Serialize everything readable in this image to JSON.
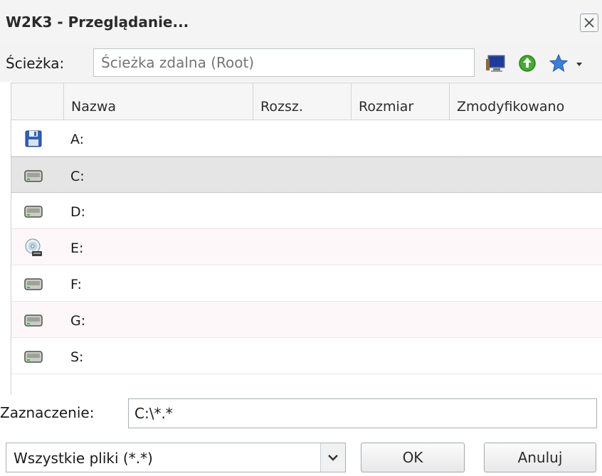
{
  "window": {
    "title": "W2K3 - Przeglądanie..."
  },
  "path": {
    "label": "Ścieżka:",
    "placeholder": "Ścieżka zdalna (Root)"
  },
  "toolbar_icons": [
    "desktop-icon",
    "go-up-icon",
    "favorites-star-icon",
    "dropdown-arrow-icon"
  ],
  "columns": [
    "Nazwa",
    "Rozsz.",
    "Rozmiar",
    "Zmodyfikowano"
  ],
  "rows": [
    {
      "name": "A:",
      "icon": "floppy-drive-icon"
    },
    {
      "name": "C:",
      "icon": "hard-drive-icon",
      "selected": true
    },
    {
      "name": "D:",
      "icon": "hard-drive-icon"
    },
    {
      "name": "E:",
      "icon": "cd-drive-icon"
    },
    {
      "name": "F:",
      "icon": "hard-drive-icon"
    },
    {
      "name": "G:",
      "icon": "hard-drive-icon"
    },
    {
      "name": "S:",
      "icon": "hard-drive-icon"
    }
  ],
  "selection": {
    "label": "Zaznaczenie:",
    "value": "C:\\*.*"
  },
  "filter": {
    "value": "Wszystkie pliki (*.*)"
  },
  "buttons": {
    "ok": "OK",
    "cancel": "Anuluj"
  }
}
